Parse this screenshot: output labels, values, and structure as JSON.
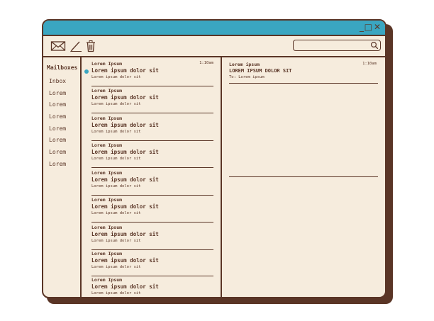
{
  "window": {
    "controls": {
      "minimize": "_",
      "maximize": "□",
      "close": "✕"
    },
    "accent": "#3aa6c1",
    "frame": "#5a3526",
    "background": "#f6ecdd"
  },
  "toolbar": {
    "icons": [
      "envelope-icon",
      "pencil-icon",
      "trash-icon"
    ],
    "search": {
      "value": "",
      "icon": "magnifier-icon"
    }
  },
  "sidebar": {
    "title": "Mailboxes",
    "items": [
      "Inbox",
      "Lorem",
      "Lorem",
      "Lorem",
      "Lorem",
      "Lorem",
      "Lorem",
      "Lorem"
    ]
  },
  "messages": [
    {
      "sender": "Lorem Ipsum",
      "subject": "Lorem ipsum dolor sit",
      "snippet": "Lorem ipsum dolor sit",
      "time": "1:10am",
      "unread": true
    },
    {
      "sender": "Lorem Ipsum",
      "subject": "Lorem ipsum dolor sit",
      "snippet": "Lorem ipsum dolor sit",
      "time": "",
      "unread": false
    },
    {
      "sender": "Lorem Ipsum",
      "subject": "Lorem ipsum dolor sit",
      "snippet": "Lorem ipsum dolor sit",
      "time": "",
      "unread": false
    },
    {
      "sender": "Lorem Ipsum",
      "subject": "Lorem ipsum dolor sit",
      "snippet": "Lorem ipsum dolor sit",
      "time": "",
      "unread": false
    },
    {
      "sender": "Lorem Ipsum",
      "subject": "Lorem ipsum dolor sit",
      "snippet": "Lorem ipsum dolor sit",
      "time": "",
      "unread": false
    },
    {
      "sender": "Lorem Ipsum",
      "subject": "Lorem ipsum dolor sit",
      "snippet": "Lorem ipsum dolor sit",
      "time": "",
      "unread": false
    },
    {
      "sender": "Lorem Ipsum",
      "subject": "Lorem ipsum dolor sit",
      "snippet": "Lorem ipsum dolor sit",
      "time": "",
      "unread": false
    },
    {
      "sender": "Lorem Ipsum",
      "subject": "Lorem ipsum dolor sit",
      "snippet": "Lorem ipsum dolor sit",
      "time": "",
      "unread": false
    },
    {
      "sender": "Lorem Ipsum",
      "subject": "Lorem ipsum dolor sit",
      "snippet": "Lorem ipsum dolor sit",
      "time": "",
      "unread": false
    }
  ],
  "reader": {
    "sender": "Lorem ipsum",
    "subject": "LOREM IPSUM DOLOR SIT",
    "to": "To: Lorem ipsum",
    "time": "1:10am"
  }
}
